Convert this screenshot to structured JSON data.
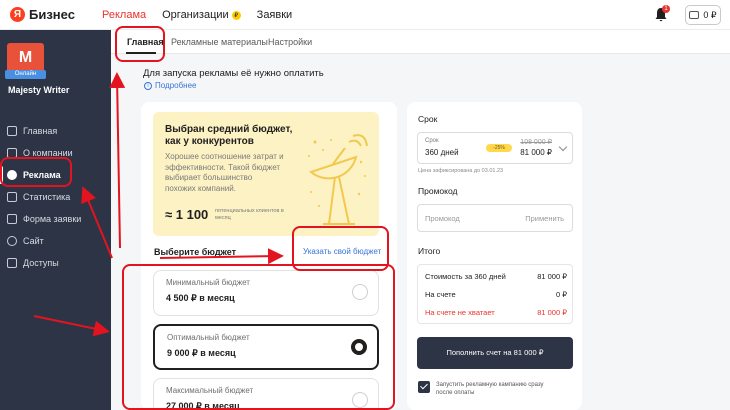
{
  "header": {
    "logo_ya": "Я",
    "logo_text": "Бизнес",
    "nav": [
      {
        "label": "Реклама",
        "active": true
      },
      {
        "label": "Организации",
        "badge": "₽"
      },
      {
        "label": "Заявки"
      }
    ],
    "notifications_count": "1",
    "balance": "0 ₽"
  },
  "sidebar": {
    "avatar_letter": "M",
    "avatar_badge": "Онлайн",
    "company_name": "Majesty Writer",
    "items": [
      {
        "label": "Главная",
        "icon": "home-icon"
      },
      {
        "label": "О компании",
        "icon": "doc-icon"
      },
      {
        "label": "Реклама",
        "icon": "target-icon",
        "active": true
      },
      {
        "label": "Статистика",
        "icon": "chart-icon"
      },
      {
        "label": "Форма заявки",
        "icon": "form-icon"
      },
      {
        "label": "Сайт",
        "icon": "globe-icon"
      },
      {
        "label": "Доступы",
        "icon": "access-icon"
      }
    ]
  },
  "tabs": [
    "Главная",
    "Рекламные материалы",
    "Настройки"
  ],
  "main": {
    "notice": "Для запуска рекламы её нужно оплатить",
    "more_link": "Подробнее",
    "promo": {
      "title": "Выбран средний бюджет, как у конкурентов",
      "description": "Хорошее соотношение затрат и эффективности. Такой бюджет выбирает большинство похожих компаний.",
      "clients_number": "≈ 1 100",
      "clients_label": "потенциальных клиентов в месяц"
    },
    "budget_title": "Выберите бюджет",
    "custom_budget_link": "Указать свой бюджет",
    "options": [
      {
        "label": "Минимальный бюджет",
        "value": "4 500 ₽ в месяц",
        "selected": false
      },
      {
        "label": "Оптимальный бюджет",
        "value": "9 000 ₽ в месяц",
        "selected": true
      },
      {
        "label": "Максимальный бюджет",
        "value": "27 000 ₽ в месяц",
        "selected": false
      }
    ]
  },
  "order": {
    "period_title": "Срок",
    "period_label": "Срок",
    "period_value": "360 дней",
    "discount_badge": "-25%",
    "old_price": "108 000 ₽",
    "new_price": "81 000 ₽",
    "price_fixed_note": "Цена зафиксирована до 03.01.23",
    "promo_title": "Промокод",
    "promo_placeholder": "Промокод",
    "promo_apply": "Применить",
    "totals_title": "Итого",
    "totals": [
      {
        "label": "Стоимость за 360 дней",
        "value": "81 000 ₽"
      },
      {
        "label": "На счете",
        "value": "0 ₽"
      },
      {
        "label": "На счете не хватает",
        "value": "81 000 ₽",
        "warn": true
      }
    ],
    "pay_button": "Пополнить счет на 81 000 ₽",
    "autostart_label": "Запустить рекламную кампанию сразу после оплаты"
  },
  "colors": {
    "accent_red": "#e8342e",
    "sidebar_bg": "#2c3445",
    "promo_bg": "#fdf2c4",
    "link_blue": "#3974d6",
    "annotation_red": "#e3141f"
  }
}
